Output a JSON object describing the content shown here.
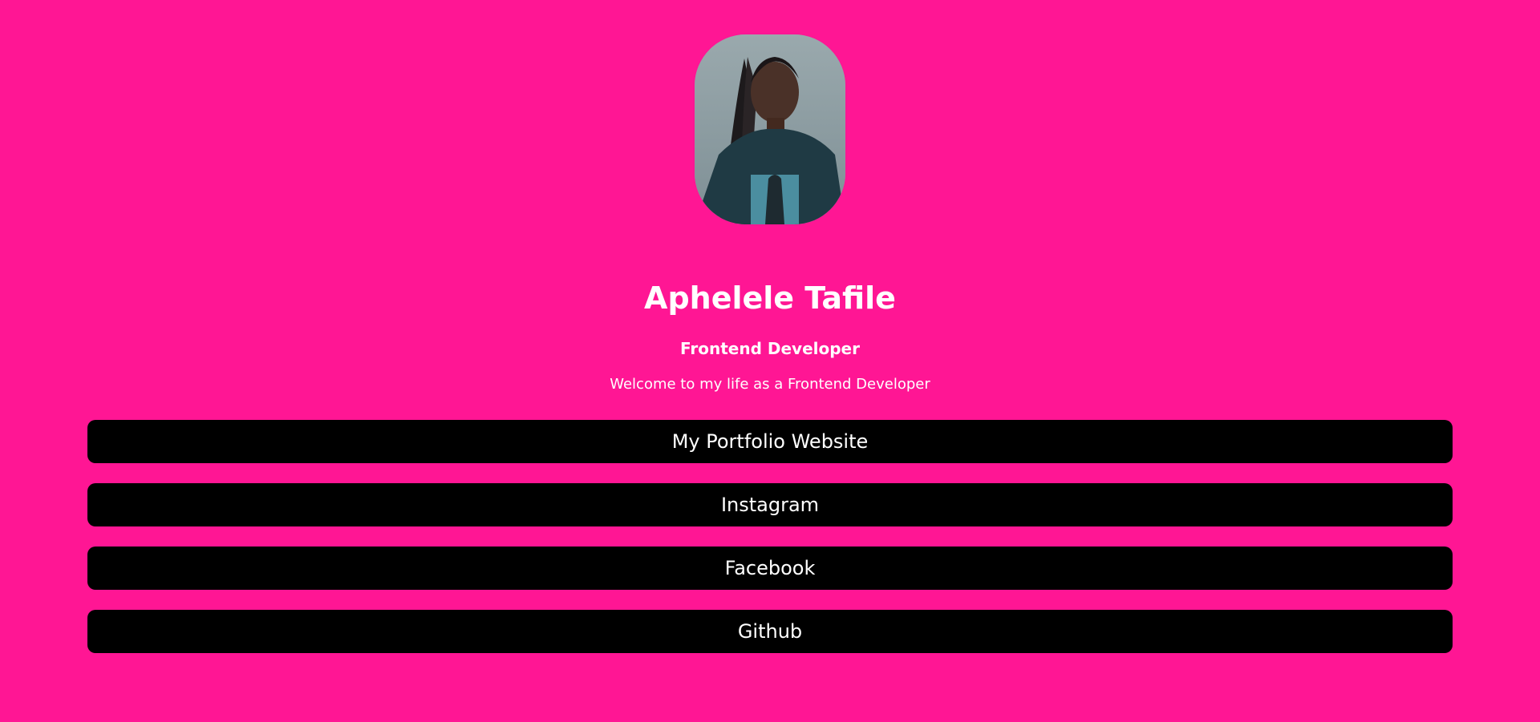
{
  "profile": {
    "name": "Aphelele Tafile",
    "role": "Frontend Developer",
    "welcome": "Welcome to my life as a Frontend Developer",
    "photo_icon": "profile-photo"
  },
  "links": [
    {
      "label": "My Portfolio Website"
    },
    {
      "label": "Instagram"
    },
    {
      "label": "Facebook"
    },
    {
      "label": "Github"
    }
  ],
  "colors": {
    "background": "#ff1694",
    "button": "#000000",
    "text": "#ffffff"
  }
}
